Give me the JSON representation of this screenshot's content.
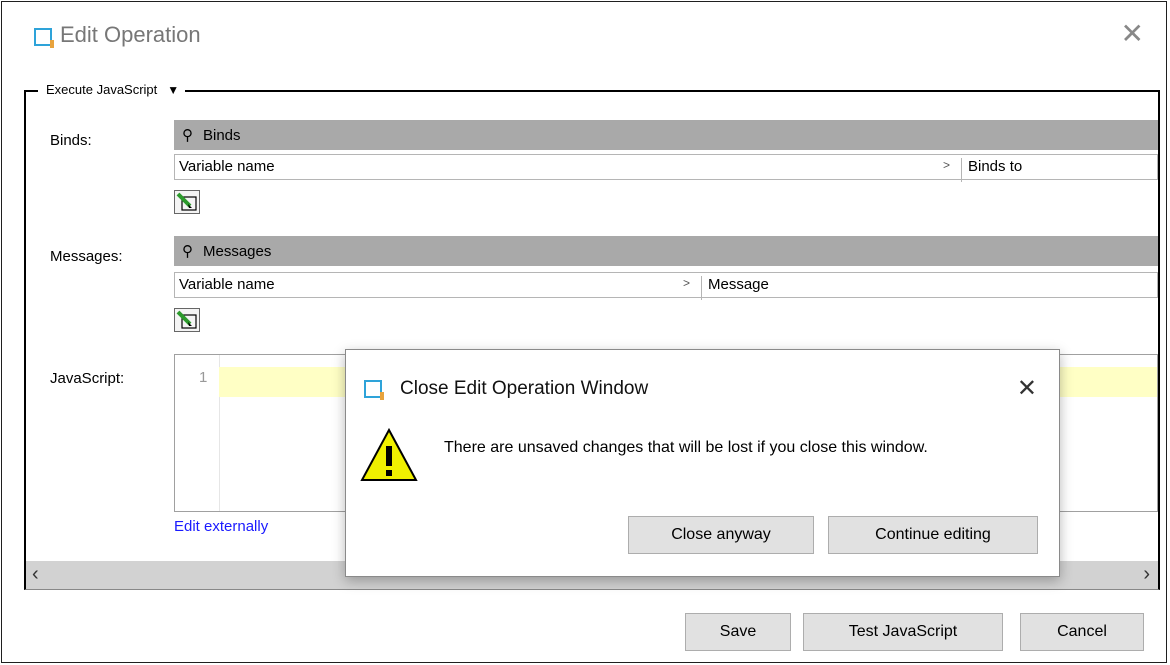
{
  "window": {
    "title": "Edit Operation"
  },
  "group": {
    "label": "Execute JavaScript"
  },
  "binds": {
    "row_label": "Binds:",
    "header": "Binds",
    "col1": "Variable name",
    "col2": "Binds to"
  },
  "messages": {
    "row_label": "Messages:",
    "header": "Messages",
    "col1": "Variable name",
    "col2": "Message"
  },
  "javascript": {
    "row_label": "JavaScript:",
    "line_number": "1",
    "edit_externally": "Edit externally"
  },
  "footer": {
    "save": "Save",
    "test": "Test JavaScript",
    "cancel": "Cancel"
  },
  "dialog": {
    "title": "Close Edit Operation Window",
    "message": "There are unsaved changes that will be lost if you close this window.",
    "close_anyway": "Close anyway",
    "continue_editing": "Continue editing"
  },
  "icons": {
    "app": "window-icon",
    "close": "close-icon",
    "dropdown": "caret-down-icon",
    "pin": "pushpin-icon",
    "edit": "pencil-edit-icon",
    "warning": "warning-icon",
    "scroll_left": "chevron-left-icon",
    "scroll_right": "chevron-right-icon"
  },
  "colors": {
    "accent": "#2ea3d9",
    "grid_header": "#a9a9a9",
    "highlight_line": "#ffffc5",
    "link": "#1a1aff",
    "warning": "#e8e800"
  }
}
